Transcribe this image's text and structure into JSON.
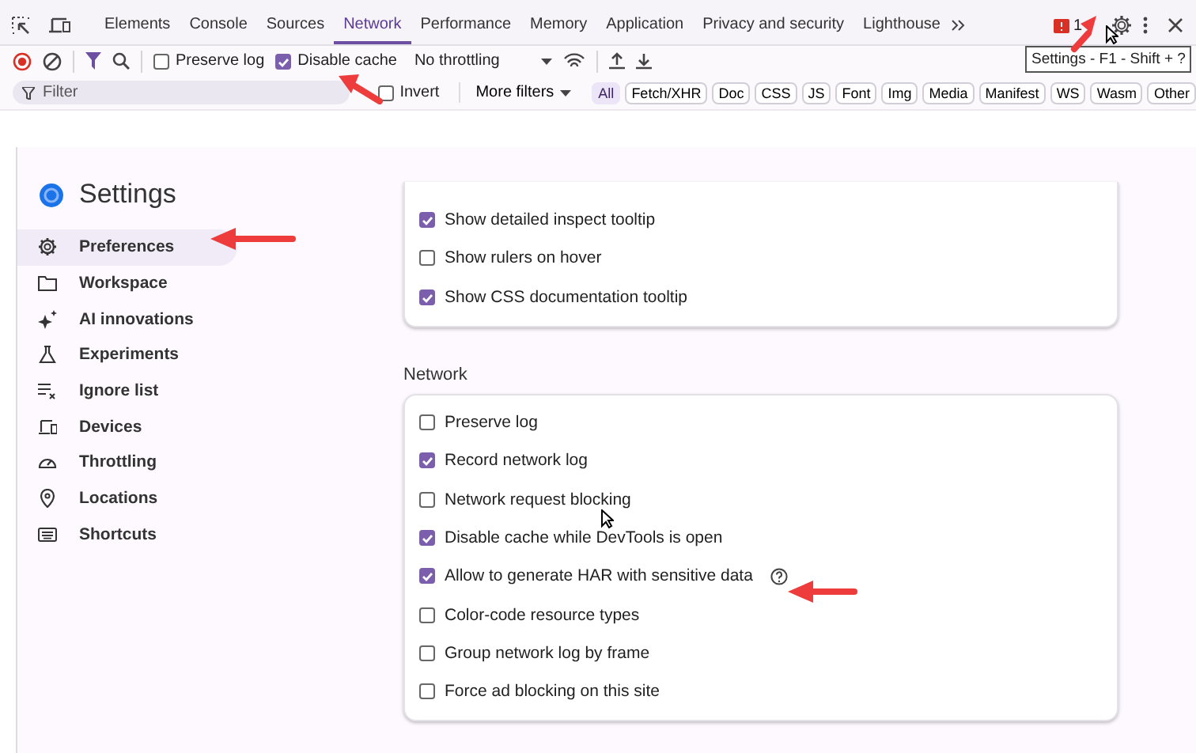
{
  "tabs": [
    {
      "label": "Elements",
      "selected": false
    },
    {
      "label": "Console",
      "selected": false
    },
    {
      "label": "Sources",
      "selected": false
    },
    {
      "label": "Network",
      "selected": true
    },
    {
      "label": "Performance",
      "selected": false
    },
    {
      "label": "Memory",
      "selected": false
    },
    {
      "label": "Application",
      "selected": false
    },
    {
      "label": "Privacy and security",
      "selected": false
    },
    {
      "label": "Lighthouse",
      "selected": false
    }
  ],
  "issues_count": "1",
  "tooltip": "Settings - F1 - Shift + ?",
  "toolbar": {
    "preserve_log": {
      "label": "Preserve log",
      "checked": false
    },
    "disable_cache": {
      "label": "Disable cache",
      "checked": true
    },
    "throttling": "No throttling"
  },
  "filter_bar": {
    "placeholder": "Filter",
    "invert": {
      "label": "Invert",
      "checked": false
    },
    "more_filters": "More filters",
    "types": [
      {
        "label": "All",
        "selected": true
      },
      {
        "label": "Fetch/XHR",
        "selected": false
      },
      {
        "label": "Doc",
        "selected": false
      },
      {
        "label": "CSS",
        "selected": false
      },
      {
        "label": "JS",
        "selected": false
      },
      {
        "label": "Font",
        "selected": false
      },
      {
        "label": "Img",
        "selected": false
      },
      {
        "label": "Media",
        "selected": false
      },
      {
        "label": "Manifest",
        "selected": false
      },
      {
        "label": "WS",
        "selected": false
      },
      {
        "label": "Wasm",
        "selected": false
      },
      {
        "label": "Other",
        "selected": false
      }
    ]
  },
  "settings": {
    "title": "Settings",
    "sidebar": [
      {
        "label": "Preferences",
        "selected": true
      },
      {
        "label": "Workspace",
        "selected": false
      },
      {
        "label": "AI innovations",
        "selected": false
      },
      {
        "label": "Experiments",
        "selected": false
      },
      {
        "label": "Ignore list",
        "selected": false
      },
      {
        "label": "Devices",
        "selected": false
      },
      {
        "label": "Throttling",
        "selected": false
      },
      {
        "label": "Locations",
        "selected": false
      },
      {
        "label": "Shortcuts",
        "selected": false
      }
    ],
    "sections": [
      {
        "items": [
          {
            "label": "Show detailed inspect tooltip",
            "checked": true,
            "help": false
          },
          {
            "label": "Show rulers on hover",
            "checked": false,
            "help": false
          },
          {
            "label": "Show CSS documentation tooltip",
            "checked": true,
            "help": false
          }
        ]
      },
      {
        "heading": "Network",
        "items": [
          {
            "label": "Preserve log",
            "checked": false,
            "help": false
          },
          {
            "label": "Record network log",
            "checked": true,
            "help": false
          },
          {
            "label": "Network request blocking",
            "checked": false,
            "help": false
          },
          {
            "label": "Disable cache while DevTools is open",
            "checked": true,
            "help": false
          },
          {
            "label": "Allow to generate HAR with sensitive data",
            "checked": true,
            "help": true
          },
          {
            "label": "Color-code resource types",
            "checked": false,
            "help": false
          },
          {
            "label": "Group network log by frame",
            "checked": false,
            "help": false
          },
          {
            "label": "Force ad blocking on this site",
            "checked": false,
            "help": false
          }
        ]
      }
    ]
  }
}
